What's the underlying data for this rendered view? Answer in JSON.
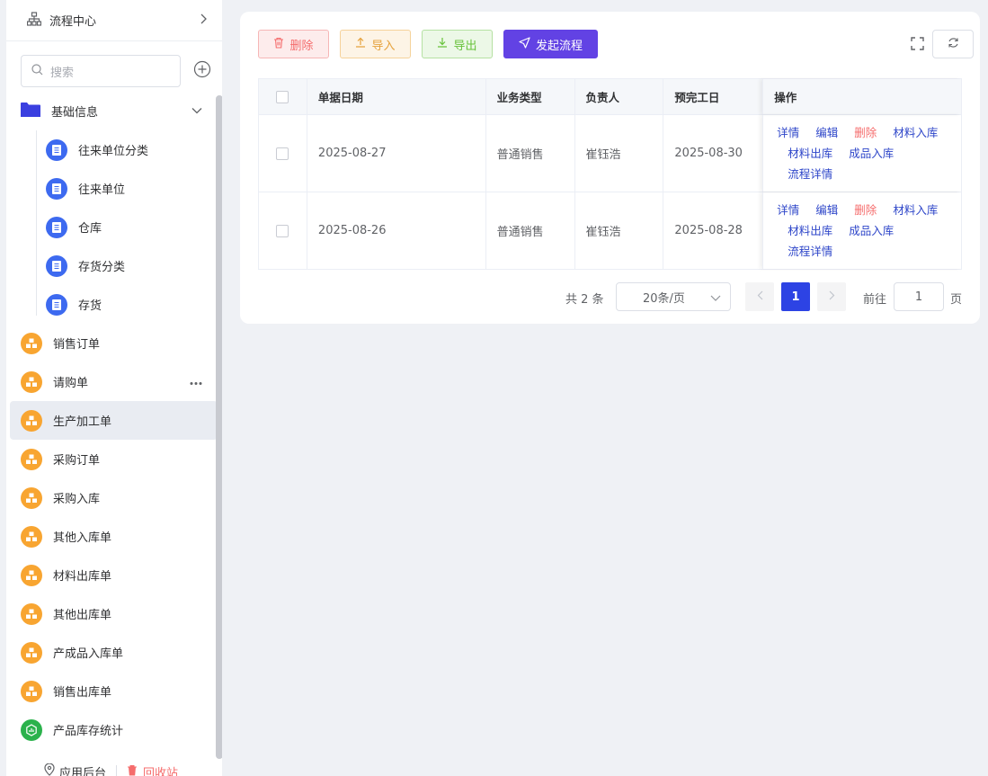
{
  "sidebar": {
    "header_title": "流程中心",
    "search_placeholder": "搜索",
    "group": {
      "label": "基础信息"
    },
    "children": [
      {
        "label": "往来单位分类"
      },
      {
        "label": "往来单位"
      },
      {
        "label": "仓库"
      },
      {
        "label": "存货分类"
      },
      {
        "label": "存货"
      }
    ],
    "items": [
      {
        "label": "销售订单"
      },
      {
        "label": "请购单"
      },
      {
        "label": "生产加工单"
      },
      {
        "label": "采购订单"
      },
      {
        "label": "采购入库"
      },
      {
        "label": "其他入库单"
      },
      {
        "label": "材料出库单"
      },
      {
        "label": "其他出库单"
      },
      {
        "label": "产成品入库单"
      },
      {
        "label": "销售出库单"
      },
      {
        "label": "产品库存统计"
      }
    ],
    "footer": {
      "admin_label": "应用后台",
      "recycle_label": "回收站"
    }
  },
  "toolbar": {
    "delete_label": "删除",
    "import_label": "导入",
    "export_label": "导出",
    "start_label": "发起流程"
  },
  "table": {
    "headers": {
      "date": "单据日期",
      "type": "业务类型",
      "owner": "负责人",
      "due": "预完工日",
      "ops": "操作"
    },
    "rows": [
      {
        "date": "2025-08-27",
        "type": "普通销售",
        "owner": "崔钰浩",
        "due": "2025-08-30"
      },
      {
        "date": "2025-08-26",
        "type": "普通销售",
        "owner": "崔钰浩",
        "due": "2025-08-28"
      }
    ],
    "ops": {
      "detail": "详情",
      "edit": "编辑",
      "delete": "删除",
      "material_in": "材料入库",
      "material_out": "材料出库",
      "product_in": "成品入库",
      "flow_detail": "流程详情"
    }
  },
  "pagination": {
    "total_text": "共 2 条",
    "page_size": "20条/页",
    "current_page": "1",
    "goto_label": "前往",
    "goto_value": "1",
    "page_unit": "页"
  },
  "colors": {
    "accent": "#6242e4",
    "page_active": "#2d43e4",
    "link": "#2e46c9",
    "danger": "#f56c6c"
  }
}
